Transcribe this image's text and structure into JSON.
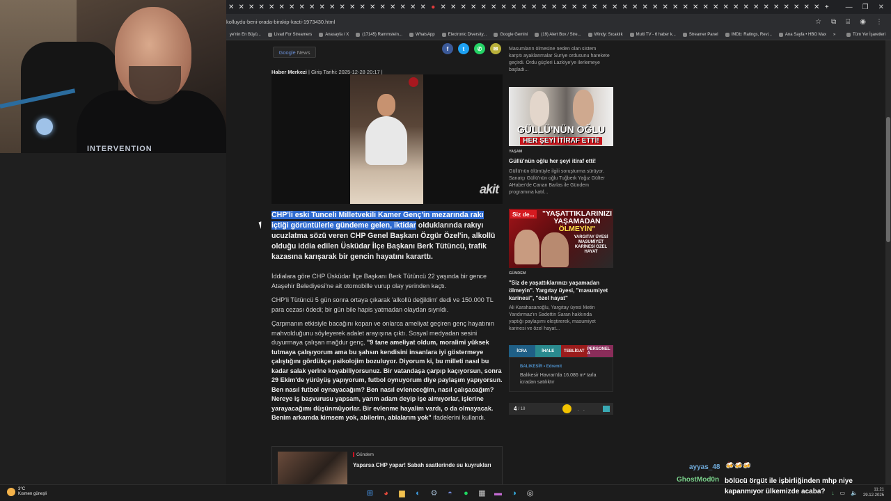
{
  "webcam": {
    "shirt_text": "INTERVENTION"
  },
  "browser": {
    "tab_count": 59,
    "url": "kolluydu-beni-orada-birakip-kacti-1973430.html",
    "bookmarks": [
      "ye'nin En Büyü...",
      "Livad For Streamers",
      "Anasayfa / X",
      "(17145) Rammstein...",
      "WhatsApp",
      "Electronic Diversity...",
      "Google Gemini",
      "(19) Alert Box / Stre...",
      "Windy: Sıcaklık",
      "Multi TV - 6 haber k...",
      "Streamer Panel",
      "IMDb: Ratings, Revi...",
      "Ana Sayfa • HBO Max"
    ],
    "bookmarks_more": "»",
    "all_bookmarks": "Tüm Yer İşaretleri"
  },
  "article": {
    "google_news": "Google News",
    "google_news_brand": "Google",
    "google_news_word": "News",
    "author": "Haber Merkezi",
    "date": "Giriş Tarihi: 2025-12-28 20:17",
    "video_watermark": "akit",
    "lead_highlight": "CHP'li eski Tunceli Milletvekili Kamer Genç'in mezarında rakı içtiği görüntülerle gündeme gelen, iktidar",
    "lead_rest": " olduklarında rakıyı ucuzlatma sözü veren CHP Genel Başkanı Özgür Özel'in, alkollü olduğu iddia edilen Üsküdar İlçe Başkanı Berk Tütüncü, trafik kazasına karışarak bir gencin hayatını kararttı.",
    "p1": "İddialara göre CHP Üsküdar İlçe Başkanı Berk Tütüncü 22 yaşında bir gence Ataşehir Belediyesi'ne ait otomobille vurup olay yerinden kaçtı.",
    "p2": "CHP'li Tütüncü 5 gün sonra ortaya çıkarak 'alkollü değildim' dedi ve 150.000 TL para cezası ödedi; bir gün bile hapis yatmadan olaydan sıyrıldı.",
    "p3_start": "Çarpmanın etkisiyle bacağını kopan ve onlarca ameliyat geçiren genç hayatının mahvolduğunu söyleyerek adalet arayışına çıktı. Sosyal medyadan sesini duyurmaya çalışan mağdur genç, ",
    "p3_quote": "\"9 tane ameliyat oldum, moralimi yüksek tutmaya çalışıyorum ama bu şahsın kendisini insanlara iyi göstermeye çalıştığını gördükçe psikolojim bozuluyor. Diyorum ki, bu milleti nasıl bu kadar salak yerine koyabiliyorsunuz. Bir vatandaşa çarpıp kaçıyorsun, sonra 29 Ekim'de yürüyüş yapıyorum, futbol oynuyorum diye paylaşım yapıyorsun. Ben nasıl futbol oynayacağım? Ben nasıl evleneceğim, nasıl çalışacağım? Nereye iş başvurusu yapsam, yarım adam deyip işe almıyorlar, işlerine yarayacağımı düşünmüyorlar. Bir evlenme hayalim vardı, o da olmayacak. Benim arkamda kimsem yok, abilerim, ablalarım yok\"",
    "p3_end": " ifadelerini kullandı.",
    "related_category": "Gündem",
    "related_title": "Yaparsa CHP yapar! Sabah saatlerinde su kuyrukları"
  },
  "sidebar": {
    "top_snippet": "Masumların ölmesine neden olan sistem karşıtı ayaklanmalar Suriye ordusunu harekete geçirdi. Ordu güçleri Lazkiye'ye ilerlemeye başladı...",
    "card1": {
      "img_line1": "GÜLLÜ'NÜN OĞLU",
      "img_line2": "HER ŞEYİ İTİRAF ETTİ!",
      "category": "YAŞAM",
      "title": "Güllü'nün oğlu her şeyi itiraf etti!",
      "snippet": "Güllü'nün ölümüyle ilgili soruşturma sürüyor. Sanatçı Güllü'nün oğlu Tuğberk Yağız Gülter AHaber'de Canan Barlas ile Gündem programına katıl..."
    },
    "card2": {
      "img_badge": "Siz de...",
      "img_line1": "\"YAŞATTIKLARINIZI",
      "img_line2": "YAŞAMADAN",
      "img_line3": "ÖLMEYİN\"",
      "img_small": "YARGITAY ÜYESİ MASUMİYET KARİNESİ ÖZEL HAYAT",
      "category": "GÜNDEM",
      "title": "\"Siz de yaşattıklarınızı yaşamadan ölmeyin\". Yargıtay üyesi, \"masumiyet karinesi\", \"özel hayat\"",
      "snippet": "Ali Karahasanoğlu, Yargıtay üyesi Metin Yandırmaz'ın Sadettin Saran hakkında yaptığı paylaşımı eleştirerek, masumiyet karinesi ve özel hayat..."
    },
    "tabs": [
      "İCRA",
      "İHALE",
      "TEBLİGAT",
      "PERSONEL A"
    ],
    "tab_colors": [
      "#1f5f86",
      "#2a8a8e",
      "#9b1c1c",
      "#8a2d5a"
    ],
    "ihale_location": "BALIKESİR • Edremit",
    "ihale_desc": "Balıkesir Havran'da 16.086 m² tarla icradan satılıktır",
    "pager_current": "4",
    "pager_total": "/ 18"
  },
  "chat": {
    "user1": "ayyas_48",
    "user1_msg": "🍻🍻🍻",
    "user2": "GhostMod0n",
    "user2_msg": "bölücü örgüt ile işbirliğinden mhp niye kapanmıyor ülkemizde acaba?"
  },
  "taskbar": {
    "weather_temp": "3°C",
    "weather_desc": "Kısmen güneşli",
    "time": "11:21",
    "date": "29.12.2025"
  },
  "colors": {
    "highlight": "#2f6bd1",
    "facebook": "#3b5998",
    "twitter": "#1da1f2",
    "whatsapp": "#25d366",
    "email": "#b8b03a"
  }
}
